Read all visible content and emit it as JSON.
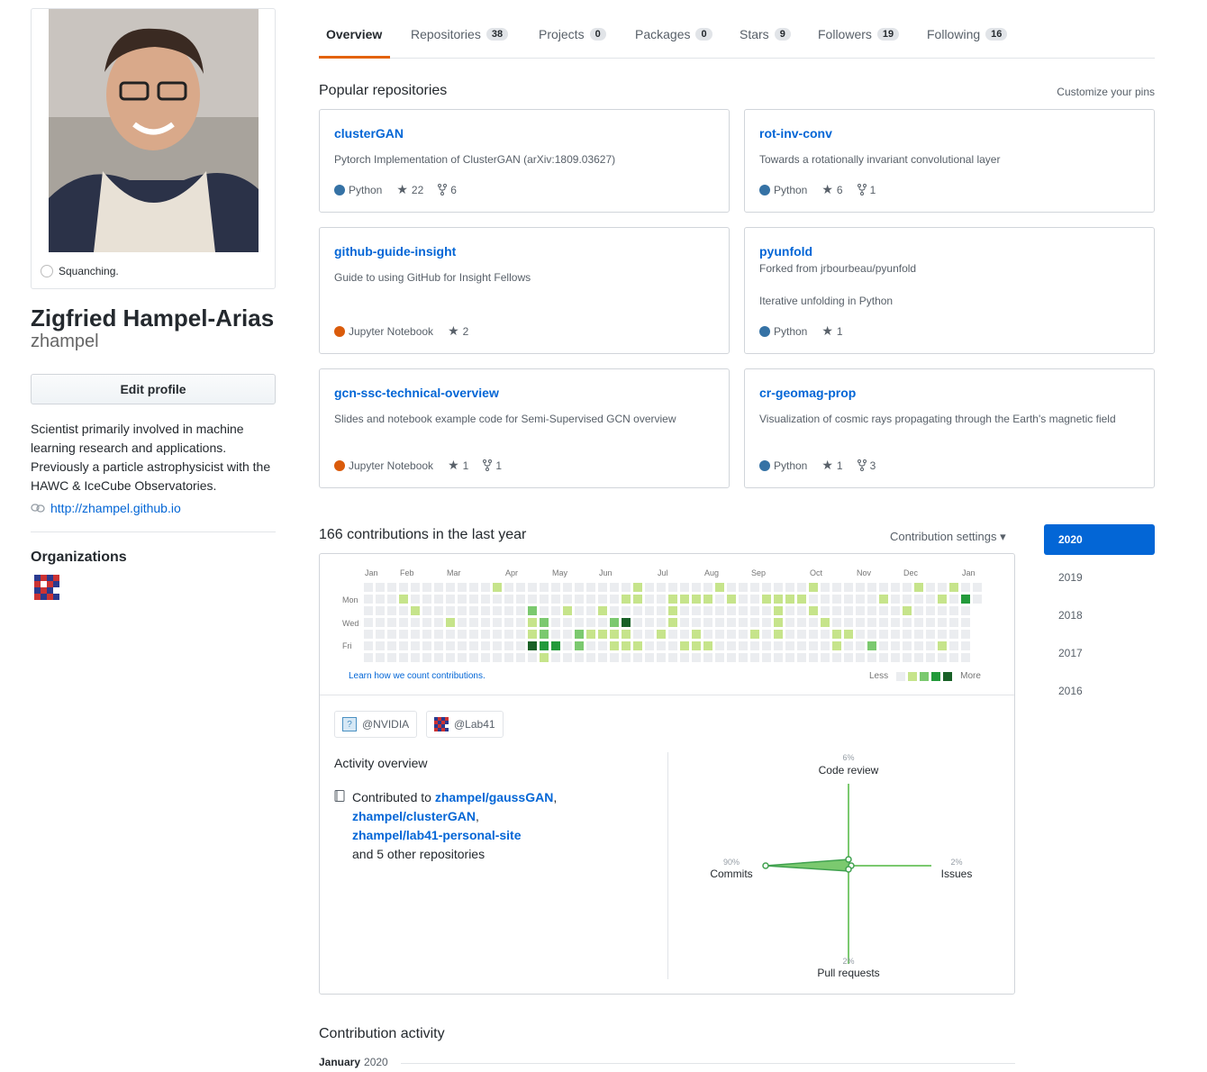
{
  "profile": {
    "status": "Squanching.",
    "fullname": "Zigfried Hampel-Arias",
    "username": "zhampel",
    "edit_label": "Edit profile",
    "bio": "Scientist primarily involved in machine learning research and applications. Previously a particle astrophysicist with the HAWC & IceCube Observatories.",
    "website": "http://zhampel.github.io",
    "organizations_title": "Organizations"
  },
  "nav": {
    "tabs": [
      {
        "label": "Overview",
        "count": ""
      },
      {
        "label": "Repositories",
        "count": "38"
      },
      {
        "label": "Projects",
        "count": "0"
      },
      {
        "label": "Packages",
        "count": "0"
      },
      {
        "label": "Stars",
        "count": "9"
      },
      {
        "label": "Followers",
        "count": "19"
      },
      {
        "label": "Following",
        "count": "16"
      }
    ]
  },
  "popular": {
    "title": "Popular repositories",
    "customize": "Customize your pins",
    "repos": [
      {
        "name": "clusterGAN",
        "forked": "",
        "desc": "Pytorch Implementation of ClusterGAN (arXiv:1809.03627)",
        "lang": "Python",
        "stars": "22",
        "forks": "6"
      },
      {
        "name": "rot-inv-conv",
        "forked": "",
        "desc": "Towards a rotationally invariant convolutional layer",
        "lang": "Python",
        "stars": "6",
        "forks": "1"
      },
      {
        "name": "github-guide-insight",
        "forked": "",
        "desc": "Guide to using GitHub for Insight Fellows",
        "lang": "Jupyter Notebook",
        "stars": "2",
        "forks": ""
      },
      {
        "name": "pyunfold",
        "forked": "Forked from jrbourbeau/pyunfold",
        "desc": "Iterative unfolding in Python",
        "lang": "Python",
        "stars": "1",
        "forks": ""
      },
      {
        "name": "gcn-ssc-technical-overview",
        "forked": "",
        "desc": "Slides and notebook example code for Semi-Supervised GCN overview",
        "lang": "Jupyter Notebook",
        "stars": "1",
        "forks": "1"
      },
      {
        "name": "cr-geomag-prop",
        "forked": "",
        "desc": "Visualization of cosmic rays propagating through the Earth's magnetic field",
        "lang": "Python",
        "stars": "1",
        "forks": "3"
      }
    ]
  },
  "colors": {
    "python": "#3572A5",
    "jupyter": "#DA5B0B",
    "accent": "#0366d6"
  },
  "contributions": {
    "title": "166 contributions in the last year",
    "settings": "Contribution settings ▾",
    "months": [
      "Jan",
      "Feb",
      "Mar",
      "Apr",
      "May",
      "Jun",
      "Jul",
      "Aug",
      "Sep",
      "Oct",
      "Nov",
      "Dec",
      "Jan"
    ],
    "days": [
      "Mon",
      "Wed",
      "Fri"
    ],
    "learn": "Learn how we count contributions.",
    "less": "Less",
    "more": "More",
    "orgs": [
      "@NVIDIA",
      "@Lab41"
    ],
    "activity_title": "Activity overview",
    "contributed_to": "Contributed to",
    "repo_links": [
      "zhampel/gaussGAN",
      "zhampel/clusterGAN",
      "zhampel/lab41-personal-site"
    ],
    "others": "and 5 other repositories",
    "radar": {
      "code_review": {
        "label": "Code review",
        "pct": "6%"
      },
      "commits": {
        "label": "Commits",
        "pct": "90%"
      },
      "issues": {
        "label": "Issues",
        "pct": "2%"
      },
      "pull_requests": {
        "label": "Pull requests",
        "pct": "2%"
      }
    }
  },
  "years": [
    "2020",
    "2019",
    "2018",
    "2017",
    "2016"
  ],
  "activity": {
    "title": "Contribution activity",
    "month": "January",
    "year": "2020"
  }
}
